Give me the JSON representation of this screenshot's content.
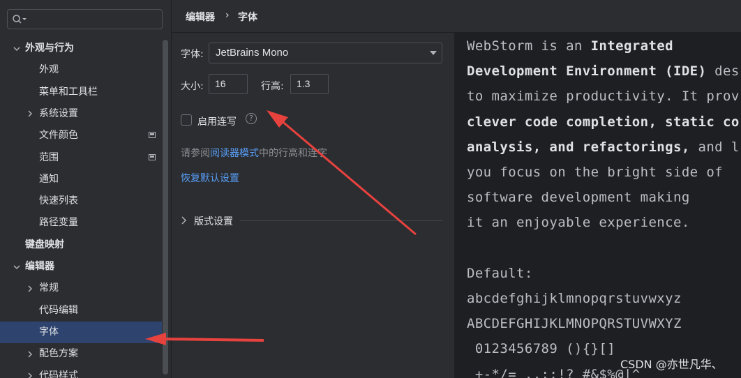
{
  "sidebar": {
    "search": {
      "value": "",
      "placeholder": ""
    },
    "items": [
      {
        "label": "外观与行为",
        "bold": true,
        "chevron": "down"
      },
      {
        "label": "外观"
      },
      {
        "label": "菜单和工具栏"
      },
      {
        "label": "系统设置",
        "chevron": "right"
      },
      {
        "label": "文件颜色",
        "badge": true
      },
      {
        "label": "范围",
        "badge": true
      },
      {
        "label": "通知"
      },
      {
        "label": "快速列表"
      },
      {
        "label": "路径变量"
      },
      {
        "label": "键盘映射",
        "bold": true
      },
      {
        "label": "编辑器",
        "bold": true,
        "chevron": "down"
      },
      {
        "label": "常规",
        "chevron": "right"
      },
      {
        "label": "代码编辑"
      },
      {
        "label": "字体",
        "selected": true
      },
      {
        "label": "配色方案",
        "chevron": "right"
      },
      {
        "label": "代码样式",
        "chevron": "right"
      }
    ]
  },
  "breadcrumb": {
    "parent": "编辑器",
    "separator": "›",
    "current": "字体"
  },
  "font_settings": {
    "font_label": "字体:",
    "font_value": "JetBrains Mono",
    "size_label": "大小:",
    "size_value": "16",
    "line_height_label": "行高:",
    "line_height_value": "1.3",
    "ligatures_label": "启用连写",
    "ligatures_checked": false,
    "help_glyph": "?",
    "hint_prefix": "请参阅",
    "hint_link": "阅读器模式",
    "hint_suffix": "中的行高和连字",
    "restore_label": "恢复默认设置",
    "typography_label": "版式设置"
  },
  "preview": {
    "lines": [
      [
        {
          "t": "WebStorm is an "
        },
        {
          "t": "Integrated",
          "b": true
        }
      ],
      [
        {
          "t": "Development Environment (IDE)",
          "b": true
        },
        {
          "t": " des"
        }
      ],
      [
        {
          "t": "to maximize productivity. It prov"
        }
      ],
      [
        {
          "t": "clever code completion, static co",
          "b": true
        }
      ],
      [
        {
          "t": "analysis, and refactorings,",
          "b": true
        },
        {
          "t": " and l"
        }
      ],
      [
        {
          "t": "you focus on the bright side of"
        }
      ],
      [
        {
          "t": "software development making"
        }
      ],
      [
        {
          "t": "it an enjoyable experience."
        }
      ],
      [
        {
          "t": ""
        }
      ],
      [
        {
          "t": "Default:"
        }
      ],
      [
        {
          "t": "abcdefghijklmnopqrstuvwxyz"
        }
      ],
      [
        {
          "t": "ABCDEFGHIJKLMNOPQRSTUVWXYZ"
        }
      ],
      [
        {
          "t": " 0123456789 (){}[]"
        }
      ],
      [
        {
          "t": " +-*/= .,;:!? #&$%@|^"
        }
      ]
    ]
  },
  "watermark": "CSDN @亦世凡华、",
  "colors": {
    "accent_link": "#589df6",
    "selection": "#2e436e",
    "annotation_arrow": "#e8423f"
  }
}
